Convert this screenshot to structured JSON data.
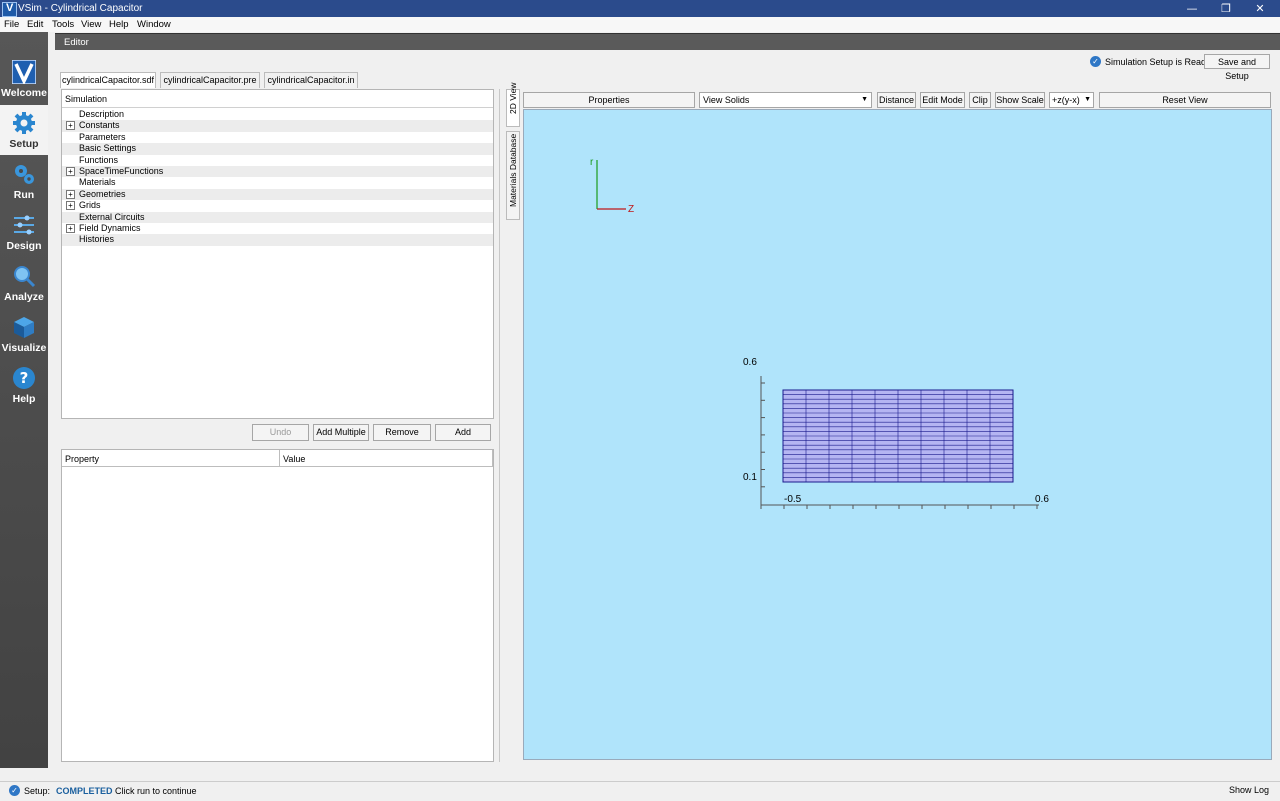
{
  "window": {
    "title": "VSim - Cylindrical Capacitor",
    "minimize_glyph": "—",
    "restore_glyph": "❐",
    "close_glyph": "✕"
  },
  "menu": [
    "File",
    "Edit",
    "Tools",
    "View",
    "Help",
    "Window"
  ],
  "dock": [
    {
      "label": "Welcome",
      "icon": "vsim-logo-icon",
      "active": false
    },
    {
      "label": "Setup",
      "icon": "gear-icon",
      "active": true
    },
    {
      "label": "Run",
      "icon": "gears-run-icon",
      "active": false
    },
    {
      "label": "Design",
      "icon": "design-icon",
      "active": false
    },
    {
      "label": "Analyze",
      "icon": "magnifier-icon",
      "active": false
    },
    {
      "label": "Visualize",
      "icon": "cube-icon",
      "active": false
    },
    {
      "label": "Help",
      "icon": "question-icon",
      "active": false
    }
  ],
  "editor": {
    "header": "Editor",
    "ready_text": "Simulation Setup is Ready",
    "save_setup_label": "Save and Setup",
    "tabs": [
      "cylindricalCapacitor.sdf",
      "cylindricalCapacitor.pre",
      "cylindricalCapacitor.in"
    ]
  },
  "tree": {
    "header": "Simulation",
    "items": [
      {
        "label": "Description",
        "expandable": false
      },
      {
        "label": "Constants",
        "expandable": true
      },
      {
        "label": "Parameters",
        "expandable": false
      },
      {
        "label": "Basic Settings",
        "expandable": false
      },
      {
        "label": "Functions",
        "expandable": false
      },
      {
        "label": "SpaceTimeFunctions",
        "expandable": true
      },
      {
        "label": "Materials",
        "expandable": false
      },
      {
        "label": "Geometries",
        "expandable": true
      },
      {
        "label": "Grids",
        "expandable": true
      },
      {
        "label": "External Circuits",
        "expandable": false
      },
      {
        "label": "Field Dynamics",
        "expandable": true
      },
      {
        "label": "Histories",
        "expandable": false
      }
    ],
    "expand_glyph": "+"
  },
  "actions": {
    "undo": "Undo",
    "add_multiple": "Add Multiple",
    "remove": "Remove",
    "add": "Add"
  },
  "props": {
    "col_property": "Property",
    "col_value": "Value"
  },
  "side_tabs": [
    "2D View",
    "Materials Database"
  ],
  "view_toolbar": {
    "properties": "Properties",
    "view_select": "View Solids",
    "distance": "Distance",
    "edit_mode": "Edit Mode",
    "clip": "Clip",
    "show_scale": "Show Scale",
    "orientation_select": "+z(y-x)",
    "reset_view": "Reset View"
  },
  "viewport": {
    "axis_vertical": "r",
    "axis_horizontal": "Z",
    "y_tick_top": "0.6",
    "y_tick_bottom": "0.1",
    "x_tick_left": "-0.5",
    "x_tick_right": "0.6",
    "grid_color": "#1a1a8c",
    "grid_fill": "#b5b5f2"
  },
  "status": {
    "prefix": "Setup:",
    "state": "COMPLETED",
    "message": "Click run to continue",
    "show_log": "Show Log"
  }
}
